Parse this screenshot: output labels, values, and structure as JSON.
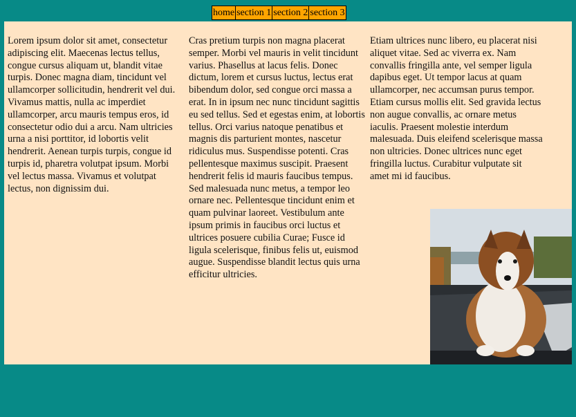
{
  "nav": {
    "items": [
      {
        "label": "home"
      },
      {
        "label": "section 1"
      },
      {
        "label": "section 2"
      },
      {
        "label": "section 3"
      }
    ]
  },
  "columns": [
    "Lorem ipsum dolor sit amet, consectetur adipiscing elit. Maecenas lectus tellus, congue cursus aliquam ut, blandit vitae turpis. Donec magna diam, tincidunt vel ullamcorper sollicitudin, hendrerit vel dui. Vivamus mattis, nulla ac imperdiet ullamcorper, arcu mauris tempus eros, id consectetur odio dui a arcu. Nam ultricies urna a nisi porttitor, id lobortis velit hendrerit. Aenean turpis turpis, congue id turpis id, pharetra volutpat ipsum. Morbi vel lectus massa. Vivamus et volutpat lectus, non dignissim dui.",
    "Cras pretium turpis non magna placerat semper. Morbi vel mauris in velit tincidunt varius. Phasellus at lacus felis. Donec dictum, lorem et cursus luctus, lectus erat bibendum dolor, sed congue orci massa a erat. In in ipsum nec nunc tincidunt sagittis eu sed tellus. Sed et egestas enim, at lobortis tellus. Orci varius natoque penatibus et magnis dis parturient montes, nascetur ridiculus mus. Suspendisse potenti. Cras pellentesque maximus suscipit. Praesent hendrerit felis id mauris faucibus tempus. Sed malesuada nunc metus, a tempor leo ornare nec. Pellentesque tincidunt enim et quam pulvinar laoreet. Vestibulum ante ipsum primis in faucibus orci luctus et ultrices posuere cubilia Curae; Fusce id ligula scelerisque, finibus felis ut, euismod augue. Suspendisse blandit lectus quis urna efficitur ultricies.",
    "Etiam ultrices nunc libero, eu placerat nisi aliquet vitae. Sed ac viverra ex. Nam convallis fringilla ante, vel semper ligula dapibus eget. Ut tempor lacus at quam ullamcorper, nec accumsan purus tempor. Etiam cursus mollis elit. Sed gravida lectus non augue convallis, ac ornare metus iaculis. Praesent molestie interdum malesuada. Duis eleifend scelerisque massa non ultricies. Donec ultrices nunc eget fringilla luctus. Curabitur vulputate sit amet mi id faucibus."
  ],
  "colors": {
    "background": "#078a87",
    "panel": "#ffe4c4",
    "nav": "#ffa500"
  }
}
